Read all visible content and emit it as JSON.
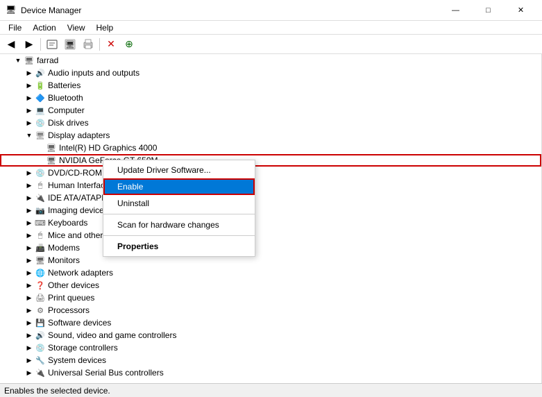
{
  "titleBar": {
    "icon": "💻",
    "title": "Device Manager",
    "minimize": "—",
    "maximize": "□",
    "close": "✕"
  },
  "menuBar": {
    "items": [
      "File",
      "Action",
      "View",
      "Help"
    ]
  },
  "toolbar": {
    "buttons": [
      "◀",
      "▶",
      "📋",
      "🖥",
      "🖨",
      "❌",
      "➕"
    ]
  },
  "tree": {
    "rootLabel": "farrad",
    "items": [
      {
        "id": "audio",
        "label": "Audio inputs and outputs",
        "indent": 1,
        "hasArrow": true,
        "expanded": false
      },
      {
        "id": "batteries",
        "label": "Batteries",
        "indent": 1,
        "hasArrow": true,
        "expanded": false
      },
      {
        "id": "bluetooth",
        "label": "Bluetooth",
        "indent": 1,
        "hasArrow": true,
        "expanded": false
      },
      {
        "id": "computer",
        "label": "Computer",
        "indent": 1,
        "hasArrow": true,
        "expanded": false
      },
      {
        "id": "diskdrives",
        "label": "Disk drives",
        "indent": 1,
        "hasArrow": true,
        "expanded": false
      },
      {
        "id": "displayadapters",
        "label": "Display adapters",
        "indent": 1,
        "hasArrow": true,
        "expanded": true
      },
      {
        "id": "intelhd",
        "label": "Intel(R) HD Graphics 4000",
        "indent": 2,
        "hasArrow": false,
        "expanded": false
      },
      {
        "id": "nvidia",
        "label": "NVIDIA GeForce GT 650M",
        "indent": 2,
        "hasArrow": false,
        "expanded": false,
        "selected": true
      },
      {
        "id": "dvdrom",
        "label": "DVD/CD-ROM drives",
        "indent": 1,
        "hasArrow": true,
        "expanded": false
      },
      {
        "id": "hid",
        "label": "Human Interface Devices",
        "indent": 1,
        "hasArrow": true,
        "expanded": false
      },
      {
        "id": "ide",
        "label": "IDE ATA/ATAPI controllers",
        "indent": 1,
        "hasArrow": true,
        "expanded": false
      },
      {
        "id": "imaging",
        "label": "Imaging devices",
        "indent": 1,
        "hasArrow": true,
        "expanded": false
      },
      {
        "id": "keyboards",
        "label": "Keyboards",
        "indent": 1,
        "hasArrow": true,
        "expanded": false
      },
      {
        "id": "mice",
        "label": "Mice and other pointing devices",
        "indent": 1,
        "hasArrow": true,
        "expanded": false
      },
      {
        "id": "modems",
        "label": "Modems",
        "indent": 1,
        "hasArrow": true,
        "expanded": false
      },
      {
        "id": "monitors",
        "label": "Monitors",
        "indent": 1,
        "hasArrow": true,
        "expanded": false
      },
      {
        "id": "network",
        "label": "Network adapters",
        "indent": 1,
        "hasArrow": true,
        "expanded": false
      },
      {
        "id": "other",
        "label": "Other devices",
        "indent": 1,
        "hasArrow": true,
        "expanded": false
      },
      {
        "id": "print",
        "label": "Print queues",
        "indent": 1,
        "hasArrow": true,
        "expanded": false
      },
      {
        "id": "processors",
        "label": "Processors",
        "indent": 1,
        "hasArrow": true,
        "expanded": false
      },
      {
        "id": "software",
        "label": "Software devices",
        "indent": 1,
        "hasArrow": true,
        "expanded": false
      },
      {
        "id": "sound",
        "label": "Sound, video and game controllers",
        "indent": 1,
        "hasArrow": true,
        "expanded": false
      },
      {
        "id": "storage",
        "label": "Storage controllers",
        "indent": 1,
        "hasArrow": true,
        "expanded": false
      },
      {
        "id": "system",
        "label": "System devices",
        "indent": 1,
        "hasArrow": true,
        "expanded": false
      },
      {
        "id": "usb",
        "label": "Universal Serial Bus controllers",
        "indent": 1,
        "hasArrow": true,
        "expanded": false
      }
    ]
  },
  "contextMenu": {
    "items": [
      {
        "id": "update",
        "label": "Update Driver Software...",
        "type": "normal"
      },
      {
        "id": "enable",
        "label": "Enable",
        "type": "highlighted"
      },
      {
        "id": "uninstall",
        "label": "Uninstall",
        "type": "normal"
      },
      {
        "id": "sep1",
        "type": "separator"
      },
      {
        "id": "scan",
        "label": "Scan for hardware changes",
        "type": "normal"
      },
      {
        "id": "sep2",
        "type": "separator"
      },
      {
        "id": "properties",
        "label": "Properties",
        "type": "bold"
      }
    ]
  },
  "statusBar": {
    "text": "Enables the selected device."
  }
}
